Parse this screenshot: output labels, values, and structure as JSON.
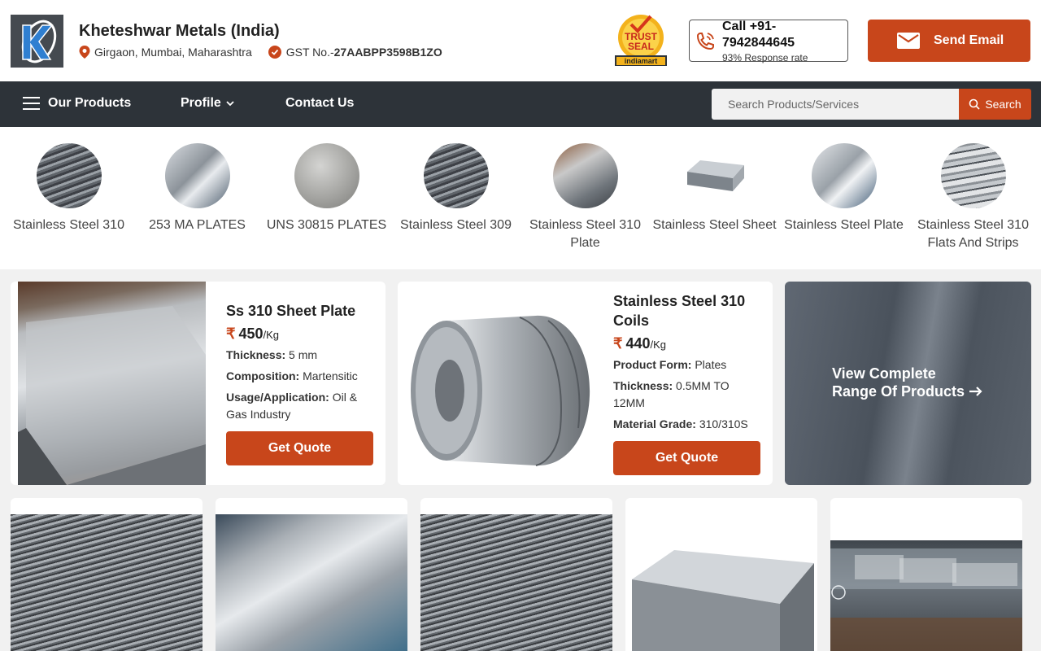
{
  "header": {
    "company_name": "Kheteshwar Metals (India)",
    "location": "Girgaon, Mumbai, Maharashtra",
    "gst_prefix": "GST No.-",
    "gst_number": "27AABPP3598B1ZO",
    "trust_seal": {
      "line1": "TRUST",
      "line2": "SEAL",
      "brand": "indiamart"
    },
    "call": {
      "label": "Call +91-7942844645",
      "response_rate": "93% Response rate"
    },
    "email_button": "Send Email"
  },
  "nav": {
    "products": "Our Products",
    "profile": "Profile",
    "contact": "Contact Us",
    "search_placeholder": "Search Products/Services",
    "search_button": "Search"
  },
  "categories": [
    {
      "label": "Stainless Steel 310"
    },
    {
      "label": "253 MA PLATES"
    },
    {
      "label": "UNS 30815 PLATES"
    },
    {
      "label": "Stainless Steel 309"
    },
    {
      "label": "Stainless Steel 310 Plate"
    },
    {
      "label": "Stainless Steel Sheet"
    },
    {
      "label": "Stainless Steel Plate"
    },
    {
      "label": "Stainless Steel 310 Flats And Strips"
    }
  ],
  "featured": [
    {
      "title": "Ss 310 Sheet Plate",
      "currency": "₹",
      "price": "450",
      "unit": "/Kg",
      "specs": [
        {
          "key": "Thickness:",
          "value": "5 mm"
        },
        {
          "key": "Composition:",
          "value": "Martensitic"
        },
        {
          "key": "Usage/Application:",
          "value": "Oil & Gas Industry"
        }
      ],
      "button": "Get Quote"
    },
    {
      "title": "Stainless Steel 310 Coils",
      "currency": "₹",
      "price": "440",
      "unit": "/Kg",
      "specs": [
        {
          "key": "Product Form:",
          "value": "Plates"
        },
        {
          "key": "Thickness:",
          "value": "0.5MM TO 12MM"
        },
        {
          "key": "Material Grade:",
          "value": "310/310S"
        }
      ],
      "button": "Get Quote"
    }
  ],
  "view_all": {
    "line1": "View Complete",
    "line2": "Range Of Products"
  },
  "colors": {
    "accent": "#c8461b",
    "nav_bg": "#2d3339",
    "page_bg": "#f1f1f1"
  }
}
